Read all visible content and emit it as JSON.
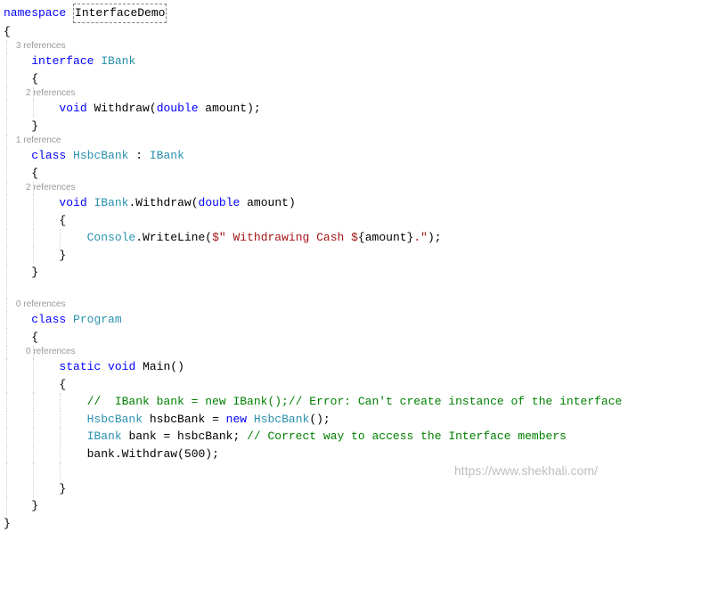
{
  "code": {
    "kw_namespace": "namespace",
    "ns_name": "InterfaceDemo",
    "brace_open": "{",
    "brace_close": "}",
    "ref3": "3 references",
    "ref2": "2 references",
    "ref1": "1 reference",
    "ref0": "0 references",
    "kw_interface": "interface",
    "type_IBank": "IBank",
    "kw_void": "void",
    "m_Withdraw": "Withdraw",
    "paren_open": "(",
    "paren_close": ")",
    "kw_double": "double",
    "p_amount": " amount",
    "semi": ";",
    "kw_class": "class",
    "type_HsbcBank": "HsbcBank",
    "colon": " : ",
    "dot": ".",
    "type_Console": "Console",
    "m_WriteLine": "WriteLine",
    "str_prefix": "$\"",
    "str_body1": " Withdrawing Cash $",
    "str_interp_open": "{",
    "str_interp_var": "amount",
    "str_interp_close": "}",
    "str_body2": ".\"",
    "type_Program": "Program",
    "kw_static": "static",
    "m_Main": "Main",
    "cmt1": "//  IBank bank = new IBank();// Error: Can't create instance of the interface",
    "var_hsbcBank": " hsbcBank",
    "eq": " = ",
    "kw_new": "new",
    "paren_empty": "()",
    "var_bank": " bank",
    "eq_hsbc": " = hsbcBank; ",
    "cmt2": "// Correct way to access the Interface members",
    "call_bank": "bank",
    "lit_500": "500"
  },
  "watermark": "https://www.shekhali.com/"
}
